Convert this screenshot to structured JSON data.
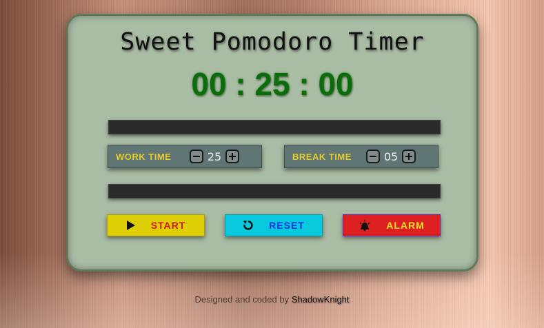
{
  "app": {
    "title": "Sweet Pomodoro Timer",
    "clock": {
      "display": "00 : 25 : 00"
    }
  },
  "work": {
    "label": "WORK TIME",
    "value": "25",
    "progress_percent": 0
  },
  "break": {
    "label": "BREAK TIME",
    "value": "05",
    "progress_percent": 0
  },
  "buttons": {
    "start": {
      "label": "START",
      "icon": "play-icon"
    },
    "reset": {
      "label": "RESET",
      "icon": "rotate-ccw-icon"
    },
    "alarm": {
      "label": "ALARM",
      "icon": "alarm-bell-icon"
    }
  },
  "footer": {
    "text": "Designed and coded by ",
    "author": "ShadowKnight"
  },
  "colors": {
    "card_bg": "#a9bca4",
    "clock": "#0c6b0a",
    "start_bg": "#ddce05",
    "reset_bg": "#08c9dd",
    "alarm_bg": "#dd2020"
  }
}
